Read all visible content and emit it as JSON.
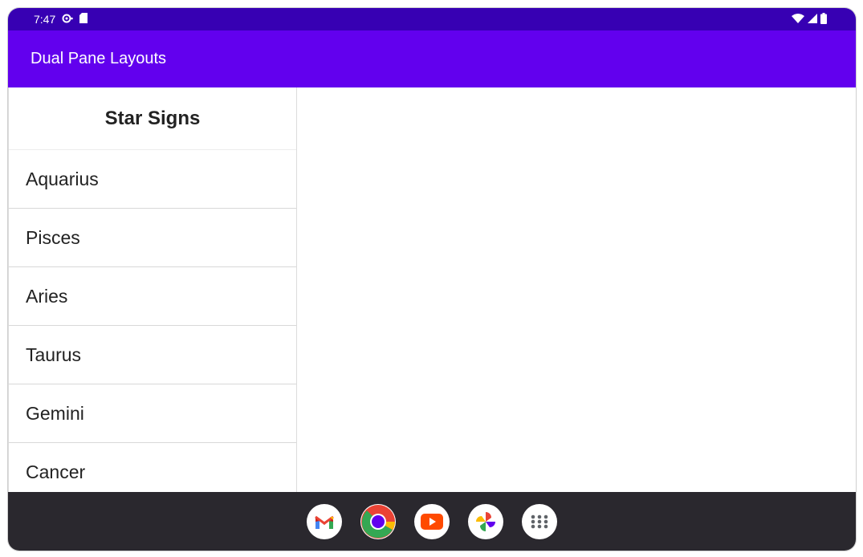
{
  "status_bar": {
    "time": "7:47",
    "left_icons": [
      "sync-icon",
      "sd-card-icon"
    ],
    "right_icons": [
      "wifi-icon",
      "signal-icon",
      "battery-icon"
    ]
  },
  "app_bar": {
    "title": "Dual Pane Layouts"
  },
  "list_pane": {
    "header": "Star Signs",
    "items": [
      {
        "label": "Aquarius"
      },
      {
        "label": "Pisces"
      },
      {
        "label": "Aries"
      },
      {
        "label": "Taurus"
      },
      {
        "label": "Gemini"
      },
      {
        "label": "Cancer"
      }
    ]
  },
  "taskbar": {
    "apps": [
      "gmail-icon",
      "chrome-icon",
      "youtube-icon",
      "photos-icon",
      "app-drawer-icon"
    ]
  },
  "colors": {
    "status_bar": "#3700b3",
    "app_bar": "#6200ee",
    "taskbar": "#2a282e"
  }
}
